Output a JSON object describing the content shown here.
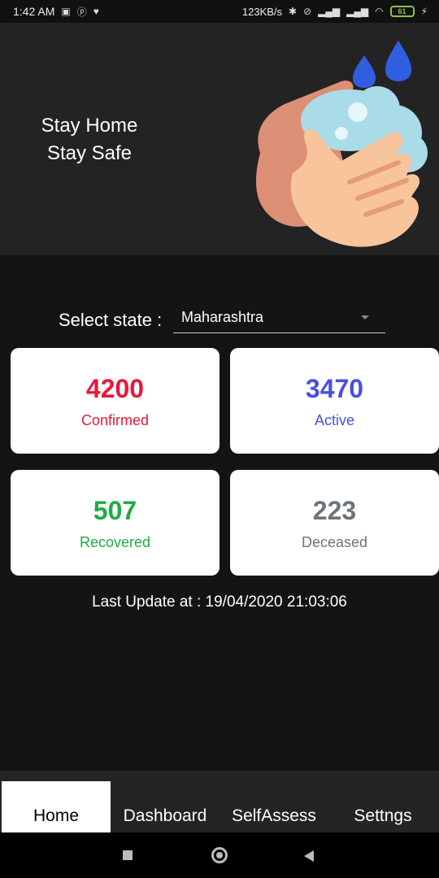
{
  "status_bar": {
    "time": "1:42 AM",
    "speed": "123KB/s",
    "battery": "61"
  },
  "banner": {
    "line1": "Stay Home",
    "line2": "Stay Safe"
  },
  "state_selector": {
    "label": "Select state :",
    "value": "Maharashtra"
  },
  "stats": [
    {
      "value": "4200",
      "label": "Confirmed",
      "color": "#e8173a"
    },
    {
      "value": "3470",
      "label": "Active",
      "color": "#4a4fdc"
    },
    {
      "value": "507",
      "label": "Recovered",
      "color": "#1fab45"
    },
    {
      "value": "223",
      "label": "Deceased",
      "color": "#6c757d"
    }
  ],
  "last_update": "Last Update at : 19/04/2020 21:03:06",
  "nav": {
    "items": [
      "Home",
      "Dashboard",
      "SelfAssess",
      "Settngs"
    ],
    "active": "Home"
  },
  "colors": {
    "confirmed": "#e8173a",
    "active": "#4a4fdc",
    "recovered": "#1fab45",
    "deceased": "#6c757d"
  }
}
